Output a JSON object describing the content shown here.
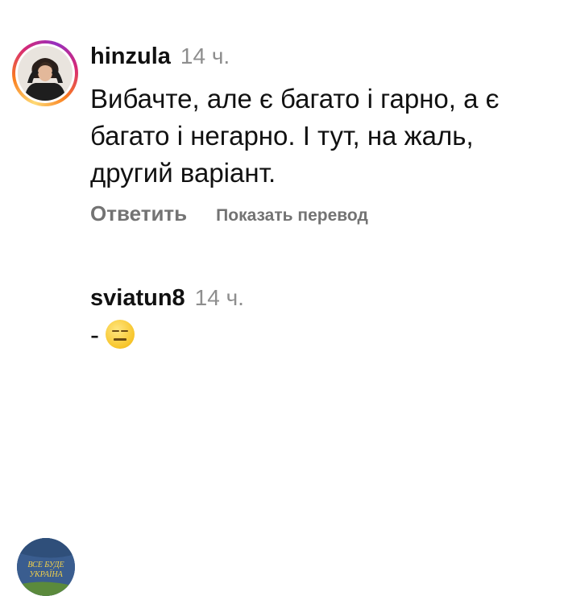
{
  "comments": [
    {
      "username": "hinzula",
      "time": "14 ч.",
      "text": "Вибачте, але є багато і гарно, а є багато і негарно. І тут, на жаль, другий варіант.",
      "reply_label": "Ответить",
      "translate_label": "Показать перевод",
      "avatar_icon": "person-photo-avatar"
    },
    {
      "username": "sviatun8",
      "time": "14 ч.",
      "text": "-",
      "emoji": "expressionless-face",
      "avatar_text": [
        "ВСЕ БУДЕ",
        "УКРАЇНА"
      ],
      "avatar_icon": "vse-bude-ukraina-avatar"
    }
  ],
  "colors": {
    "avatar2_bg": "#3a5d8f",
    "avatar2_text": "#f4d24a"
  }
}
